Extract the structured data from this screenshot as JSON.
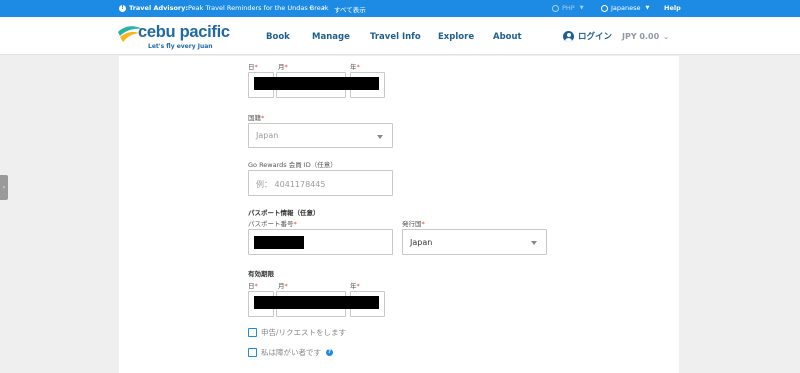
{
  "topbar": {
    "advisory_label": "Travel Advisory:",
    "advisory_text": "Peak Travel Reminders for the Undas Break",
    "prev": "‹",
    "next": "›",
    "show_all": "すべて表示",
    "currency": "PHP",
    "language": "Japanese",
    "help": "Help"
  },
  "header": {
    "brand": "cebu pacific",
    "tagline": "Let's fly every Juan",
    "nav": [
      "Book",
      "Manage",
      "Travel Info",
      "Explore",
      "About"
    ],
    "login": "ログイン",
    "balance": "JPY 0.00"
  },
  "form": {
    "dob": {
      "day_label": "日",
      "month_label": "月",
      "year_label": "年"
    },
    "nationality": {
      "label": "国籍",
      "value": "Japan"
    },
    "go_rewards": {
      "label": "Go Rewards 会員 ID（任意）",
      "placeholder": "例： 4041178445"
    },
    "passport_section": "パスポート情報（任意）",
    "passport_number_label": "パスポート番号",
    "issuing_country": {
      "label": "発行国",
      "value": "Japan"
    },
    "expiry_section": "有効期限",
    "expiry": {
      "day_label": "日",
      "month_label": "月",
      "year_label": "年"
    },
    "checkbox_declare": "申告/リクエストをします",
    "checkbox_disability": "私は障がい者です"
  },
  "colors": {
    "topbar": "#1d8be3",
    "brand_blue": "#1f6aa5",
    "required": "#e0463a",
    "redaction": "#000000"
  }
}
